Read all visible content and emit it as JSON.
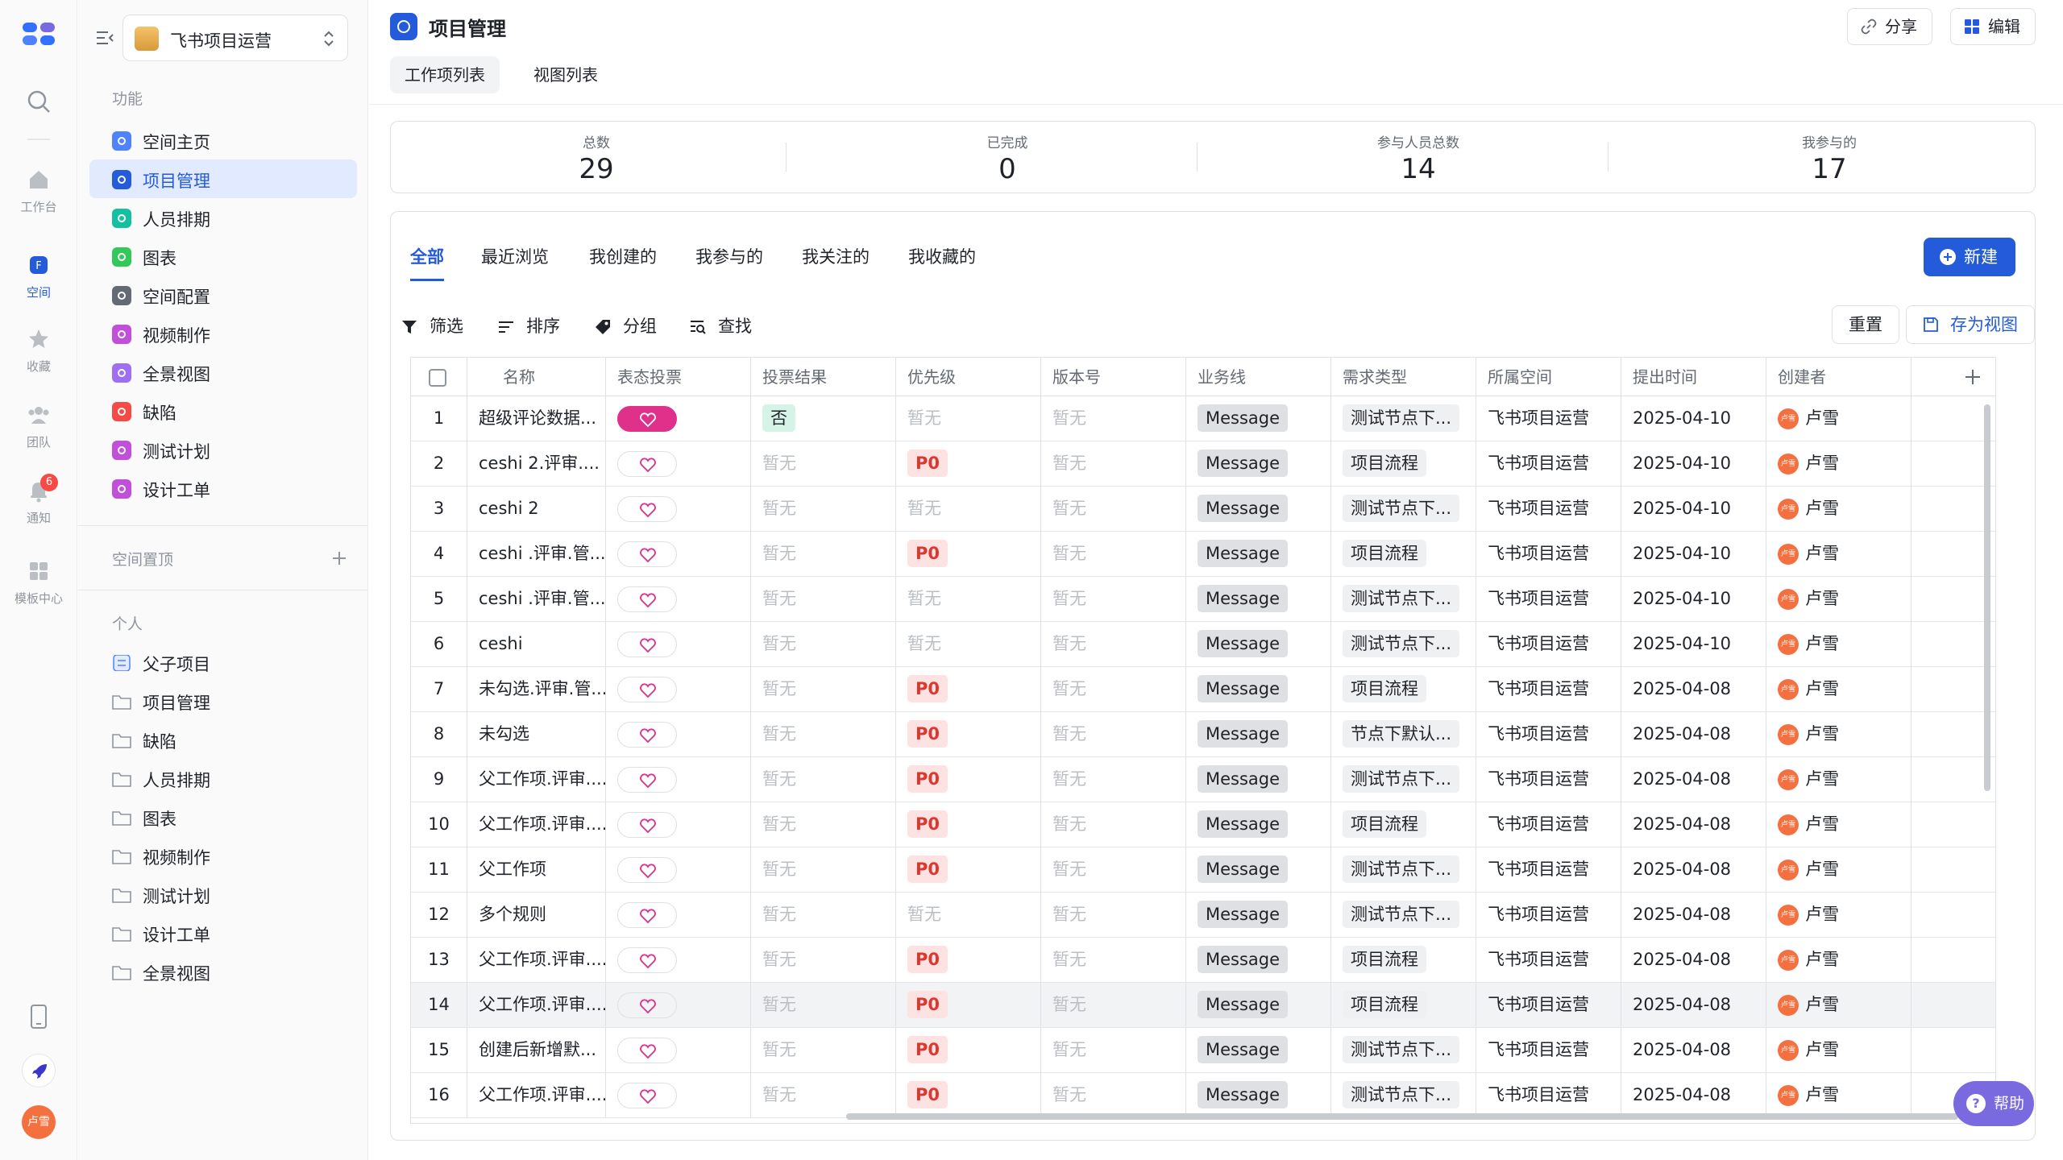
{
  "rail": {
    "items": [
      {
        "label": "工作台"
      },
      {
        "label": "空间"
      },
      {
        "label": "收藏"
      },
      {
        "label": "团队"
      },
      {
        "label": "通知",
        "badge": "6"
      },
      {
        "label": "模板中心"
      }
    ],
    "user_avatar": "卢雪"
  },
  "sidebar": {
    "space_name": "飞书项目运营",
    "section_function": "功能",
    "function_items": [
      {
        "label": "空间主页",
        "color": "#4e83fd"
      },
      {
        "label": "项目管理",
        "color": "#245bdb"
      },
      {
        "label": "人员排期",
        "color": "#14c0a0"
      },
      {
        "label": "图表",
        "color": "#33c85a"
      },
      {
        "label": "空间配置",
        "color": "#646a73"
      },
      {
        "label": "视频制作",
        "color": "#c14fd9"
      },
      {
        "label": "全景视图",
        "color": "#9f6ff1"
      },
      {
        "label": "缺陷",
        "color": "#f54a45"
      },
      {
        "label": "测试计划",
        "color": "#c14fd9"
      },
      {
        "label": "设计工单",
        "color": "#c14fd9"
      }
    ],
    "section_pinned": "空间置顶",
    "section_personal": "个人",
    "personal_items": [
      {
        "label": "父子项目"
      },
      {
        "label": "项目管理"
      },
      {
        "label": "缺陷"
      },
      {
        "label": "人员排期"
      },
      {
        "label": "图表"
      },
      {
        "label": "视频制作"
      },
      {
        "label": "测试计划"
      },
      {
        "label": "设计工单"
      },
      {
        "label": "全景视图"
      }
    ]
  },
  "header": {
    "title": "项目管理",
    "share_label": "分享",
    "edit_label": "编辑",
    "view_tabs": [
      {
        "label": "工作项列表"
      },
      {
        "label": "视图列表"
      }
    ]
  },
  "stats": [
    {
      "label": "总数",
      "value": "29"
    },
    {
      "label": "已完成",
      "value": "0"
    },
    {
      "label": "参与人员总数",
      "value": "14"
    },
    {
      "label": "我参与的",
      "value": "17"
    }
  ],
  "filter_tabs": [
    {
      "label": "全部"
    },
    {
      "label": "最近浏览"
    },
    {
      "label": "我创建的"
    },
    {
      "label": "我参与的"
    },
    {
      "label": "我关注的"
    },
    {
      "label": "我收藏的"
    }
  ],
  "new_label": "新建",
  "toolbar": {
    "filter": "筛选",
    "sort": "排序",
    "group": "分组",
    "find": "查找",
    "reset": "重置",
    "save_view": "存为视图"
  },
  "table": {
    "columns": [
      "名称",
      "表态投票",
      "投票结果",
      "优先级",
      "版本号",
      "业务线",
      "需求类型",
      "所属空间",
      "提出时间",
      "创建者"
    ],
    "rows": [
      {
        "n": "1",
        "name": "超级评论数据...",
        "vote": "on",
        "result": "否",
        "prio": "暂无",
        "ver": "暂无",
        "biz": "Message",
        "type": "测试节点下...",
        "space": "飞书项目运营",
        "date": "2025-04-10",
        "creator": "卢雪"
      },
      {
        "n": "2",
        "name": "ceshi 2.评审....",
        "vote": "off",
        "result": "暂无",
        "prio": "P0",
        "ver": "暂无",
        "biz": "Message",
        "type": "项目流程",
        "space": "飞书项目运营",
        "date": "2025-04-10",
        "creator": "卢雪"
      },
      {
        "n": "3",
        "name": "ceshi 2",
        "vote": "off",
        "result": "暂无",
        "prio": "暂无",
        "ver": "暂无",
        "biz": "Message",
        "type": "测试节点下...",
        "space": "飞书项目运营",
        "date": "2025-04-10",
        "creator": "卢雪"
      },
      {
        "n": "4",
        "name": "ceshi .评审.管...",
        "vote": "off",
        "result": "暂无",
        "prio": "P0",
        "ver": "暂无",
        "biz": "Message",
        "type": "项目流程",
        "space": "飞书项目运营",
        "date": "2025-04-10",
        "creator": "卢雪"
      },
      {
        "n": "5",
        "name": "ceshi .评审.管...",
        "vote": "off",
        "result": "暂无",
        "prio": "暂无",
        "ver": "暂无",
        "biz": "Message",
        "type": "测试节点下...",
        "space": "飞书项目运营",
        "date": "2025-04-10",
        "creator": "卢雪"
      },
      {
        "n": "6",
        "name": "ceshi",
        "vote": "off",
        "result": "暂无",
        "prio": "暂无",
        "ver": "暂无",
        "biz": "Message",
        "type": "测试节点下...",
        "space": "飞书项目运营",
        "date": "2025-04-10",
        "creator": "卢雪"
      },
      {
        "n": "7",
        "name": "未勾选.评审.管...",
        "vote": "off",
        "result": "暂无",
        "prio": "P0",
        "ver": "暂无",
        "biz": "Message",
        "type": "项目流程",
        "space": "飞书项目运营",
        "date": "2025-04-08",
        "creator": "卢雪"
      },
      {
        "n": "8",
        "name": "未勾选",
        "vote": "off",
        "result": "暂无",
        "prio": "P0",
        "ver": "暂无",
        "biz": "Message",
        "type": "节点下默认...",
        "space": "飞书项目运营",
        "date": "2025-04-08",
        "creator": "卢雪"
      },
      {
        "n": "9",
        "name": "父工作项.评审....",
        "vote": "off",
        "result": "暂无",
        "prio": "P0",
        "ver": "暂无",
        "biz": "Message",
        "type": "测试节点下...",
        "space": "飞书项目运营",
        "date": "2025-04-08",
        "creator": "卢雪"
      },
      {
        "n": "10",
        "name": "父工作项.评审....",
        "vote": "off",
        "result": "暂无",
        "prio": "P0",
        "ver": "暂无",
        "biz": "Message",
        "type": "项目流程",
        "space": "飞书项目运营",
        "date": "2025-04-08",
        "creator": "卢雪"
      },
      {
        "n": "11",
        "name": "父工作项",
        "vote": "off",
        "result": "暂无",
        "prio": "P0",
        "ver": "暂无",
        "biz": "Message",
        "type": "测试节点下...",
        "space": "飞书项目运营",
        "date": "2025-04-08",
        "creator": "卢雪"
      },
      {
        "n": "12",
        "name": "多个规则",
        "vote": "off",
        "result": "暂无",
        "prio": "暂无",
        "ver": "暂无",
        "biz": "Message",
        "type": "测试节点下...",
        "space": "飞书项目运营",
        "date": "2025-04-08",
        "creator": "卢雪"
      },
      {
        "n": "13",
        "name": "父工作项.评审....",
        "vote": "off",
        "result": "暂无",
        "prio": "P0",
        "ver": "暂无",
        "biz": "Message",
        "type": "项目流程",
        "space": "飞书项目运营",
        "date": "2025-04-08",
        "creator": "卢雪"
      },
      {
        "n": "14",
        "name": "父工作项.评审....",
        "vote": "off",
        "result": "暂无",
        "prio": "P0",
        "ver": "暂无",
        "biz": "Message",
        "type": "项目流程",
        "space": "飞书项目运营",
        "date": "2025-04-08",
        "creator": "卢雪"
      },
      {
        "n": "15",
        "name": "创建后新增默...",
        "vote": "off",
        "result": "暂无",
        "prio": "P0",
        "ver": "暂无",
        "biz": "Message",
        "type": "测试节点下...",
        "space": "飞书项目运营",
        "date": "2025-04-08",
        "creator": "卢雪"
      },
      {
        "n": "16",
        "name": "父工作项.评审....",
        "vote": "off",
        "result": "暂无",
        "prio": "P0",
        "ver": "暂无",
        "biz": "Message",
        "type": "测试节点下...",
        "space": "飞书项目运营",
        "date": "2025-04-08",
        "creator": "卢雪"
      }
    ]
  },
  "help_label": "帮助"
}
